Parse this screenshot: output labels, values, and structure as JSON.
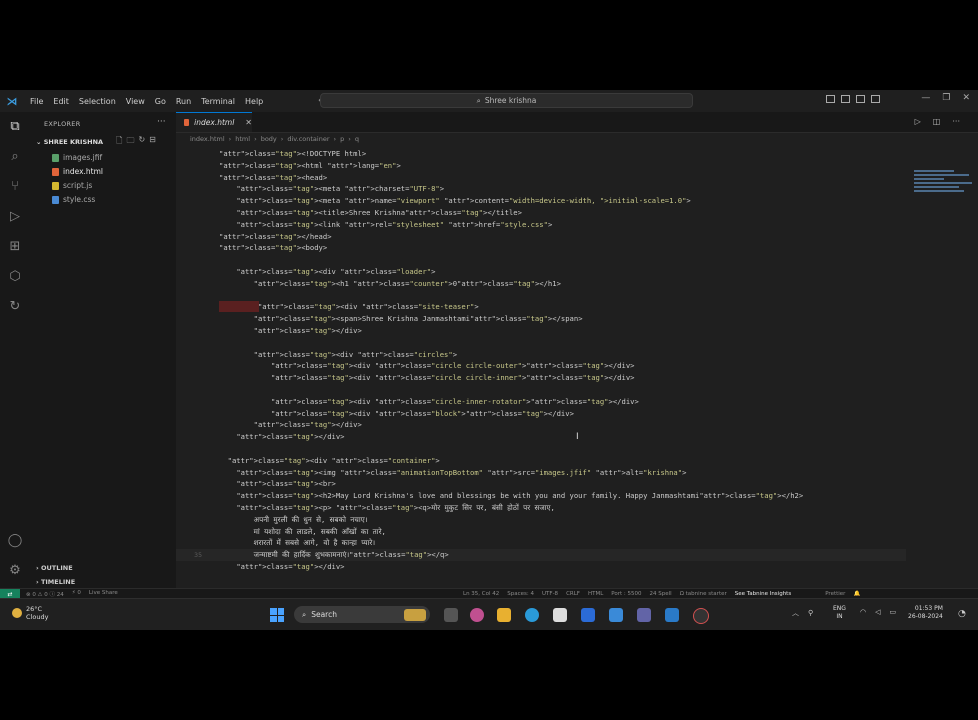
{
  "titlebar": {
    "menu": [
      "File",
      "Edit",
      "Selection",
      "View",
      "Go",
      "Run",
      "Terminal",
      "Help"
    ],
    "search": "Shree krishna"
  },
  "explorer": {
    "header": "EXPLORER",
    "folder": "SHREE KRISHNA",
    "files": [
      {
        "name": "images.jfif",
        "color": "#5aa06a"
      },
      {
        "name": "index.html",
        "color": "#e0643a"
      },
      {
        "name": "script.js",
        "color": "#d4b830"
      },
      {
        "name": "style.css",
        "color": "#4a8ad4"
      }
    ],
    "outline": "OUTLINE",
    "timeline": "TIMELINE"
  },
  "editor": {
    "tab": "index.html",
    "breadcrumb": [
      "index.html",
      "html",
      "body",
      "div.container",
      "p",
      "q"
    ],
    "lines": [
      {
        "n": "",
        "text": "<!DOCTYPE html>"
      },
      {
        "n": "",
        "text": "<html lang=\"en\">"
      },
      {
        "n": "",
        "text": "<head>"
      },
      {
        "n": "",
        "text": "    <meta charset=\"UTF-8\">"
      },
      {
        "n": "",
        "text": "    <meta name=\"viewport\" content=\"width=device-width, initial-scale=1.0\">"
      },
      {
        "n": "",
        "text": "    <title>Shree Krishna</title>"
      },
      {
        "n": "",
        "text": "    <link rel=\"stylesheet\" href=\"style.css\">"
      },
      {
        "n": "",
        "text": "</head>"
      },
      {
        "n": "",
        "text": "<body>"
      },
      {
        "n": "",
        "text": ""
      },
      {
        "n": "",
        "text": "    <div class=\"loader\">"
      },
      {
        "n": "",
        "text": "        <h1 class=\"counter\">0</h1>"
      },
      {
        "n": "",
        "text": ""
      },
      {
        "n": "",
        "text": "         <div class=\"site-teaser\">"
      },
      {
        "n": "",
        "text": "        <span>Shree Krishna Janmashtami</span>"
      },
      {
        "n": "",
        "text": "        </div>"
      },
      {
        "n": "",
        "text": ""
      },
      {
        "n": "",
        "text": "        <div class=\"circles\">"
      },
      {
        "n": "",
        "text": "            <div class=\"circle circle-outer\"></div>"
      },
      {
        "n": "",
        "text": "            <div class=\"circle circle-inner\"></div>"
      },
      {
        "n": "",
        "text": ""
      },
      {
        "n": "",
        "text": "            <div class=\"circle-inner-rotator\"></div>"
      },
      {
        "n": "",
        "text": "            <div class=\"block\"></div>"
      },
      {
        "n": "",
        "text": "        </div>"
      },
      {
        "n": "",
        "text": "    </div>"
      },
      {
        "n": "",
        "text": ""
      },
      {
        "n": "",
        "text": "  <div class=\"container\">"
      },
      {
        "n": "",
        "text": "    <img class=\"animationTopBottom\" src=\"images.jfif\" alt=\"krishna\">"
      },
      {
        "n": "",
        "text": "    <br>"
      },
      {
        "n": "",
        "text": "    <h2>May Lord Krishna's love and blessings be with you and your family. Happy Janmashtami</h2>"
      },
      {
        "n": "",
        "text": "    <p> <q>मोर मुकुट सिर पर, बंसी होठों पर सजाए,"
      },
      {
        "n": "",
        "text": "        अपनी मुरली की धुन से, सबको नचाए।"
      },
      {
        "n": "",
        "text": "        मां यशोदा की लाडले, सबकी आँखों का तारे,"
      },
      {
        "n": "",
        "text": "        शरारतों में सबसे आगे, वो है कान्हा प्यारे।"
      },
      {
        "n": "35",
        "text": "        जन्माष्टमी की हार्दिक शुभकामनाएं।</q>"
      },
      {
        "n": "",
        "text": "    </div>"
      }
    ]
  },
  "status": {
    "left": [
      "⊗ 0 ⚠ 0 ⓘ 24",
      "⚡ 0",
      "Live Share"
    ],
    "right": [
      "Ln 35, Col 42",
      "Spaces: 4",
      "UTF-8",
      "CRLF",
      "HTML",
      "Port : 5500",
      "24 Spell",
      "Ω tabnine starter"
    ],
    "tabnine": "See Tabnine Insights",
    "prettier": "Prettier"
  },
  "taskbar": {
    "temp": "26°C",
    "weather": "Cloudy",
    "search": "Search",
    "lang1": "ENG",
    "lang2": "IN",
    "time": "01:53 PM",
    "date": "26-08-2024"
  }
}
